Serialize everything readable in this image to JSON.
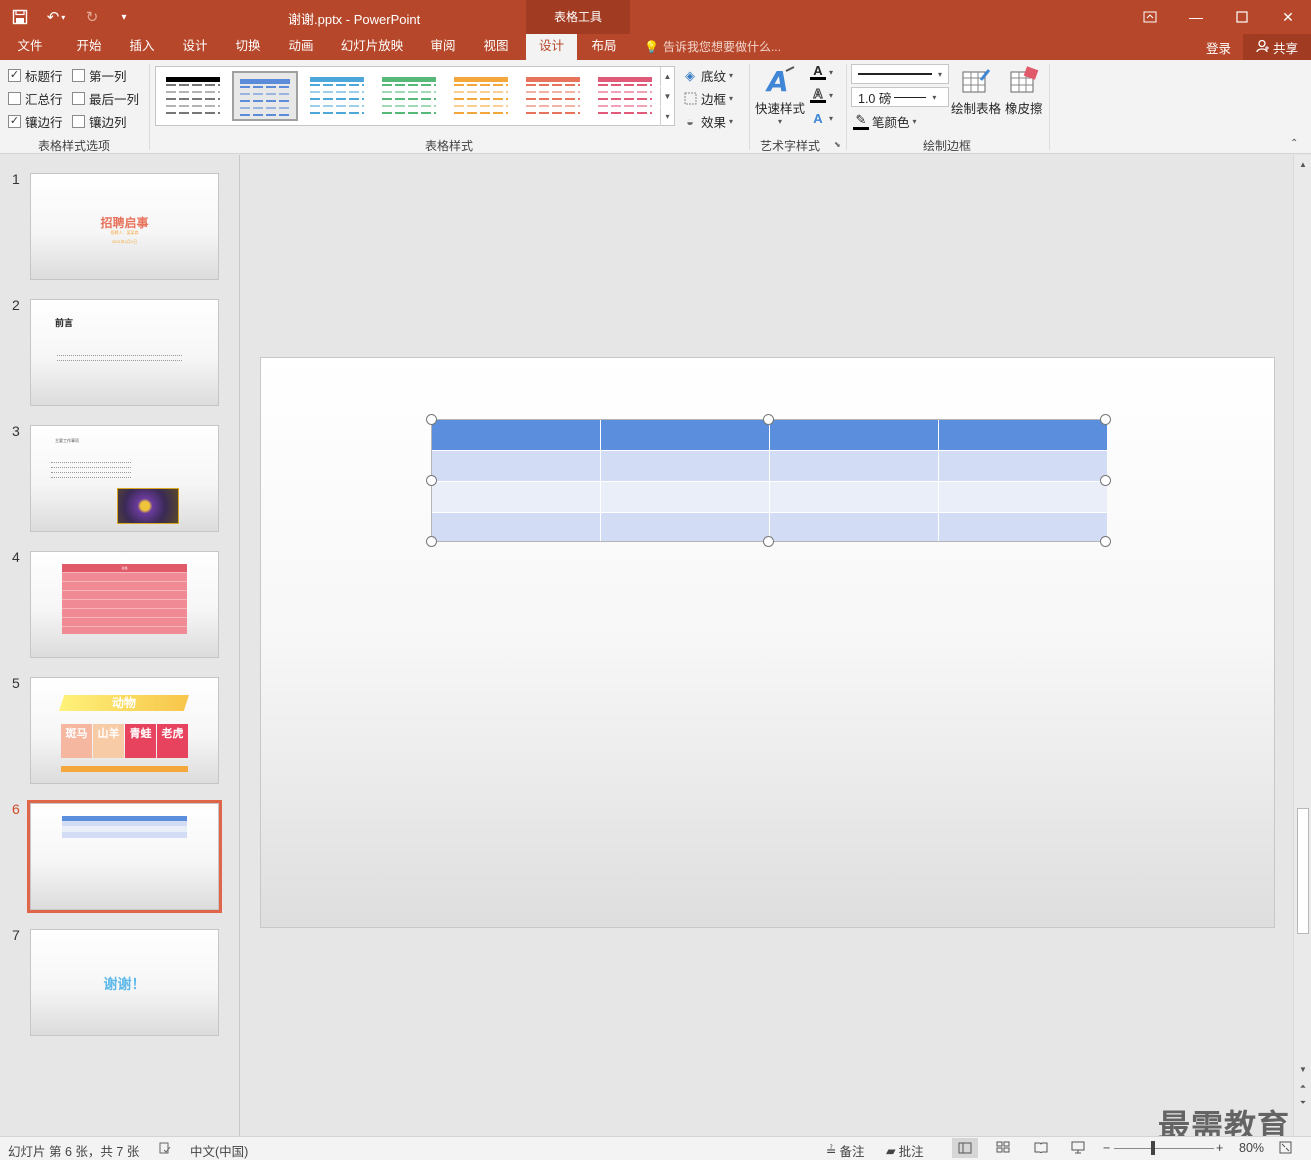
{
  "window": {
    "title": "谢谢.pptx - PowerPoint",
    "context_tab_header": "表格工具"
  },
  "tabs": [
    {
      "label": "文件"
    },
    {
      "label": "开始"
    },
    {
      "label": "插入"
    },
    {
      "label": "设计"
    },
    {
      "label": "切换"
    },
    {
      "label": "动画"
    },
    {
      "label": "幻灯片放映"
    },
    {
      "label": "审阅"
    },
    {
      "label": "视图"
    },
    {
      "label": "设计"
    },
    {
      "label": "布局"
    }
  ],
  "tellme": "告诉我您想要做什么...",
  "login": "登录",
  "share": "共享",
  "ribbon": {
    "options": {
      "header_row": "标题行",
      "first_col": "第一列",
      "total_row": "汇总行",
      "last_col": "最后一列",
      "banded_rows": "镶边行",
      "banded_cols": "镶边列",
      "group": "表格样式选项"
    },
    "styles": {
      "group": "表格样式",
      "shading": "底纹",
      "borders": "边框",
      "effects": "效果",
      "swatch_colors": [
        "#000000",
        "#5b8bd9",
        "#4da7d9",
        "#56b97a",
        "#f4a83c",
        "#e8735c",
        "#e05a7a"
      ]
    },
    "wordart": {
      "quick_styles": "快速样式",
      "group": "艺术字样式"
    },
    "draw": {
      "pen_weight": "1.0 磅",
      "pen_color": "笔颜色",
      "draw_table": "绘制表格",
      "eraser": "橡皮擦",
      "group": "绘制边框"
    }
  },
  "slides": [
    {
      "num": "1",
      "title": "招聘启事",
      "subtitle": "招聘人：某某商",
      "date": "2021年1月1日"
    },
    {
      "num": "2",
      "title": "前言"
    },
    {
      "num": "3",
      "title": "主要工作事项"
    },
    {
      "num": "4",
      "title": "表格"
    },
    {
      "num": "5",
      "title": "动物",
      "cells": [
        "斑马",
        "山羊",
        "青蛙",
        "老虎"
      ]
    },
    {
      "num": "6"
    },
    {
      "num": "7",
      "title": "谢谢！"
    }
  ],
  "table": {
    "header_color": "#5b8fde",
    "band1_color": "#d3dcf5",
    "band2_color": "#eaeef9"
  },
  "status": {
    "slide_info": "幻灯片 第 6 张，共 7 张",
    "language": "中文(中国)",
    "notes": "备注",
    "comments": "批注",
    "zoom": "80%"
  },
  "watermark": "最需教育"
}
